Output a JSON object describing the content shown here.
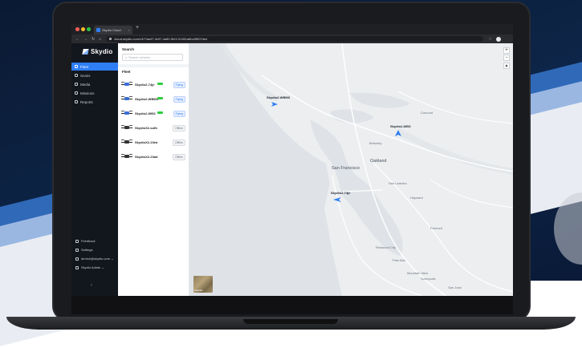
{
  "browser": {
    "tab_label": "Skydio Cloud",
    "tab_close": "×",
    "new_tab": "+",
    "url": "cloud.skydio.com/v3/74acf7-3c97-4a80-9fc3-91361a6bc5f507ded"
  },
  "app": {
    "logo": "Skydio",
    "nav": [
      {
        "label": "Fleet",
        "icon": "grid-icon"
      },
      {
        "label": "Scans",
        "icon": "eye-icon"
      },
      {
        "label": "Media",
        "icon": "media-icon"
      },
      {
        "label": "Missions",
        "icon": "target-icon"
      },
      {
        "label": "Reports",
        "icon": "chart-icon"
      }
    ],
    "bottom_nav": [
      {
        "label": "Feedback",
        "icon": "chat-icon"
      },
      {
        "label": "Settings",
        "icon": "gear-icon"
      },
      {
        "label": "derrick@skydio.com ⌄",
        "icon": "user-icon"
      },
      {
        "label": "Skydio Admin ⌄",
        "icon": "building-icon"
      }
    ],
    "collapse_glyph": "‹"
  },
  "panel": {
    "search_title": "Search",
    "search_placeholder": "Search vehicles",
    "fleet_title": "Fleet",
    "vehicles": [
      {
        "name": "Skydio2-74je",
        "status": "Flying",
        "battery": true
      },
      {
        "name": "Skydio2-WBMX",
        "status": "Flying",
        "battery": true
      },
      {
        "name": "Skydio2-8953",
        "status": "Flying",
        "battery": true
      },
      {
        "name": "SkydioX2-sofb",
        "status": "Offline",
        "battery": false
      },
      {
        "name": "SkydioX2-23eb",
        "status": "Offline",
        "battery": false
      },
      {
        "name": "SkydioX2-23ad",
        "status": "Offline",
        "battery": false
      }
    ]
  },
  "map": {
    "labels": {
      "sf": "San Francisco",
      "oakland": "Oakland",
      "berkeley": "Berkeley",
      "hayward": "Hayward",
      "fremont": "Fremont",
      "palo_alto": "Palo Alto",
      "mountain_view": "Mountain View",
      "sunnyvale": "Sunnyvale",
      "san_jose": "San Jose",
      "concord": "Concord",
      "san_leandro": "San Leandro",
      "redwood_city": "Redwood City"
    },
    "vehicles": {
      "wbmx": "Skydio2-WBMX",
      "v8953": "Skydio2-8953",
      "v74je": "Skydio2-74je"
    },
    "zoom_in": "+",
    "zoom_out": "−",
    "compass": "▲",
    "minimap_label": "Satellite"
  },
  "colors": {
    "accent": "#2f7ef3",
    "sidebar": "#12161d",
    "battery": "#2ecc40"
  }
}
